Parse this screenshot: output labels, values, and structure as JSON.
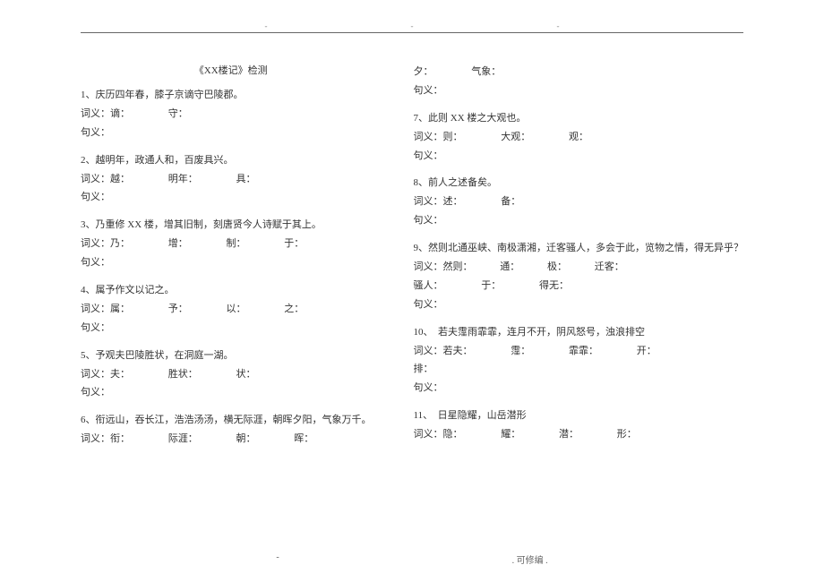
{
  "header": {
    "mark1": "-",
    "mark2": "-",
    "mark3": "-"
  },
  "title": "《XX楼记》检测",
  "left": [
    {
      "q": "1、庆历四年春，膝子京谪守巴陵郡。",
      "defs": [
        "词义：谪：",
        "守："
      ],
      "meaning": "句义："
    },
    {
      "q": "2、越明年，政通人和，百废具兴。",
      "defs": [
        "词义：越：",
        "明年：",
        "具："
      ],
      "meaning": "句义："
    },
    {
      "q": "3、乃重修 XX 楼，增其旧制，刻唐贤今人诗赋于其上。",
      "defs": [
        "词义：乃：",
        "增：",
        "制：",
        "于："
      ],
      "meaning": "句义："
    },
    {
      "q": "4、属予作文以记之。",
      "defs": [
        "词义：属：",
        "予：",
        "以：",
        "之："
      ],
      "meaning": "句义："
    },
    {
      "q": "5、予观夫巴陵胜状，在洞庭一湖。",
      "defs": [
        "词义：夫：",
        "胜状：",
        "状："
      ],
      "meaning": "句义："
    },
    {
      "q": "6、衔远山，吞长江，浩浩汤汤，横无际涯，朝晖夕阳，气象万千。",
      "defs": [
        "词义：衔：",
        "际涯：",
        "朝：",
        "晖："
      ],
      "meaning": ""
    }
  ],
  "right_top": {
    "defs": [
      "夕：",
      "气象："
    ],
    "meaning": "句义："
  },
  "right": [
    {
      "q": "7、此则 XX 楼之大观也。",
      "defs": [
        "词义：则：",
        "大观：",
        "观："
      ],
      "meaning": "句义："
    },
    {
      "q": "8、前人之述备矣。",
      "defs": [
        "词义：述：",
        "备："
      ],
      "meaning": "句义："
    },
    {
      "q": "9、然则北通巫峡、南极潇湘，迁客骚人，多会于此，览物之情，得无异乎？",
      "defs1": [
        "词义：然则：",
        "通：",
        "极：",
        "迁客："
      ],
      "defs2": [
        "骚人：",
        "于：",
        "得无："
      ],
      "meaning": "句义："
    },
    {
      "q": "10、　若夫霪雨霏霏，连月不开，阴风怒号，浊浪排空",
      "defs1": [
        "词义：若夫：",
        "霪：",
        "霏霏：",
        "开："
      ],
      "defs2": [
        "排："
      ],
      "meaning": "句义："
    },
    {
      "q": "11、　日星隐耀，山岳潜形",
      "defs": [
        "词义：隐：",
        "耀：",
        "潜：",
        "形："
      ],
      "meaning": ""
    }
  ],
  "footer": {
    "left": "-",
    "right": ". 可修编 ."
  }
}
